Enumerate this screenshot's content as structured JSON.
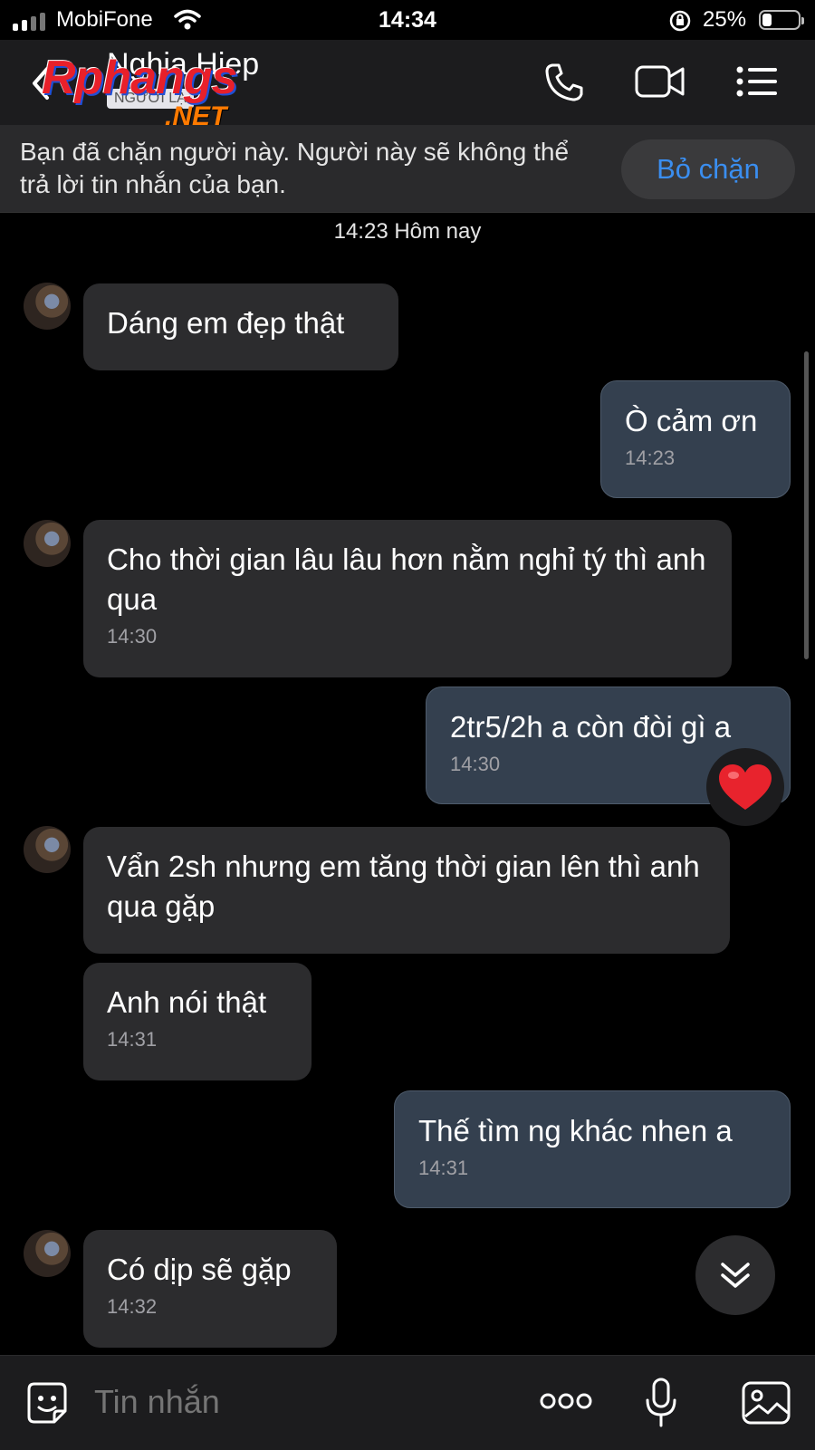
{
  "status_bar": {
    "carrier": "MobiFone",
    "time": "14:34",
    "battery_percent": "25%",
    "battery_level": 0.25,
    "icons": [
      "signal-icon",
      "wifi-icon",
      "rotation-lock-icon",
      "battery-icon"
    ]
  },
  "header": {
    "contact_name": "Nghia Hiep",
    "stranger_tag": "NGƯỜI LẠ",
    "watermark": "Rphangs",
    "watermark_suffix": ".NET",
    "icons": [
      "back-icon",
      "phone-icon",
      "video-call-icon",
      "menu-list-icon"
    ]
  },
  "banner": {
    "text": "Bạn đã chặn người này. Người này sẽ không thể trả lời tin nhắn của bạn.",
    "unblock_label": "Bỏ chặn"
  },
  "date_separator": "14:23 Hôm nay",
  "messages": [
    {
      "dir": "in",
      "text": "Dáng em đẹp thật",
      "time": ""
    },
    {
      "dir": "out",
      "text": "Ò cảm ơn",
      "time": "14:23"
    },
    {
      "dir": "in",
      "text": "Cho thời gian lâu lâu hơn nằm nghỉ tý thì anh qua",
      "time": "14:30"
    },
    {
      "dir": "out",
      "text": "2tr5/2h a còn đòi gì a",
      "time": "14:30",
      "reaction": "heart"
    },
    {
      "dir": "in",
      "text": "Vẩn 2sh nhưng em tăng thời gian lên thì anh qua gặp",
      "time": ""
    },
    {
      "dir": "in",
      "text": "Anh nói thật",
      "time": "14:31"
    },
    {
      "dir": "out",
      "text": "Thế tìm ng khác nhen a",
      "time": "14:31"
    },
    {
      "dir": "in",
      "text": "Có dịp sẽ gặp",
      "time": "14:32"
    }
  ],
  "composer": {
    "placeholder": "Tin nhắn",
    "icons": [
      "sticker-icon",
      "more-options-icon",
      "microphone-icon",
      "image-icon"
    ]
  },
  "colors": {
    "background": "#000000",
    "header": "#1c1c1e",
    "incoming_bubble": "#2c2c2e",
    "outgoing_bubble": "#34404f",
    "accent": "#3a8ef0"
  }
}
